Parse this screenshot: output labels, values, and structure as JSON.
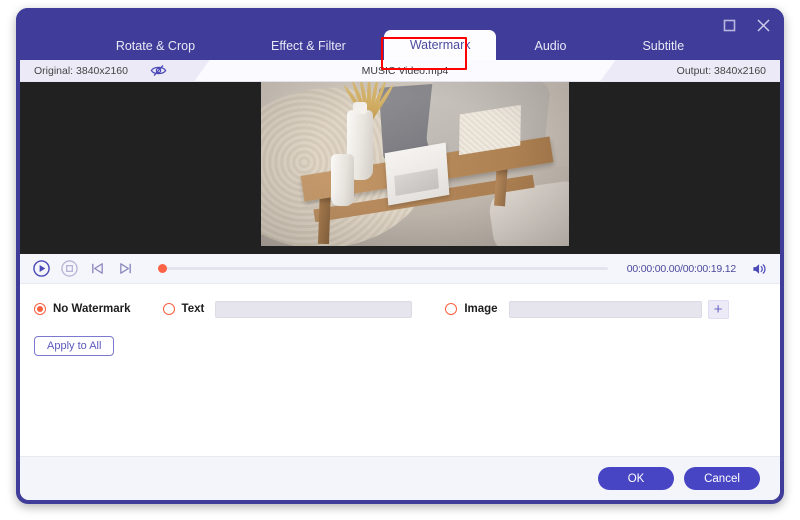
{
  "window": {
    "controls": {
      "maximize": "maximize-button",
      "close": "close-button"
    }
  },
  "tabs": [
    {
      "label": "Rotate & Crop",
      "active": false
    },
    {
      "label": "Effect & Filter",
      "active": false
    },
    {
      "label": "Watermark",
      "active": true
    },
    {
      "label": "Audio",
      "active": false
    },
    {
      "label": "Subtitle",
      "active": false
    }
  ],
  "infobar": {
    "original": "Original: 3840x2160",
    "eye_icon": "eye-off-icon",
    "filename": "MUSIC Video.mp4",
    "output": "Output: 3840x2160"
  },
  "player": {
    "play_icon": "play-circle-icon",
    "stop_icon": "stop-circle-icon",
    "prev_icon": "previous-frame-icon",
    "next_icon": "next-frame-icon",
    "time": "00:00:00.00/00:00:19.12",
    "volume_icon": "volume-icon",
    "progress_percent": 0,
    "playhead_color": "#fc6244"
  },
  "watermark": {
    "no_watermark": {
      "label": "No Watermark",
      "selected": true
    },
    "text": {
      "label": "Text",
      "selected": false,
      "value": ""
    },
    "image": {
      "label": "Image",
      "selected": false,
      "value": "",
      "add_label": "+"
    },
    "apply_all": "Apply to All"
  },
  "footer": {
    "ok": "OK",
    "cancel": "Cancel"
  },
  "colors": {
    "header_purple": "#3f3d99",
    "accent_orange": "#f8603f",
    "button_purple": "#4845c4",
    "highlight_red": "#ff0000",
    "preview_black": "#212121"
  }
}
